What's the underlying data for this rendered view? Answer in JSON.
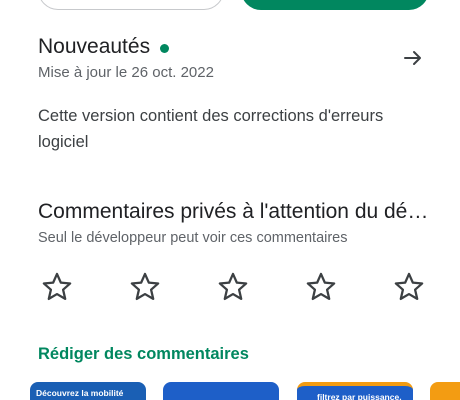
{
  "whats_new": {
    "title": "Nouveautés",
    "updated": "Mise à jour le 26 oct. 2022",
    "body": "Cette version contient des corrections d'erreurs logiciel"
  },
  "feedback": {
    "title": "Commentaires privés à l'attention du développeur",
    "subtitle": "Seul le développeur peut voir ces commentaires",
    "rating": 0,
    "max_rating": 5,
    "write_label": "Rédiger des commentaires"
  },
  "screenshots": [
    {
      "text": "Découvrez la mobilité",
      "color": "#1a5fb4",
      "text_color": "#ffffff"
    },
    {
      "text": "",
      "color": "#1e5fc8",
      "text_color": "#ffffff"
    },
    {
      "text": "filtrez par puissance,",
      "color": "#1e5fc8",
      "text_color": "#ffffff"
    },
    {
      "text": "",
      "color": "#f39c12",
      "text_color": "#ffffff"
    }
  ],
  "colors": {
    "accent": "#01875f",
    "star_outline": "#3c4043"
  },
  "icons": {
    "arrow": "arrow-right-icon",
    "star": "star-outline-icon"
  }
}
